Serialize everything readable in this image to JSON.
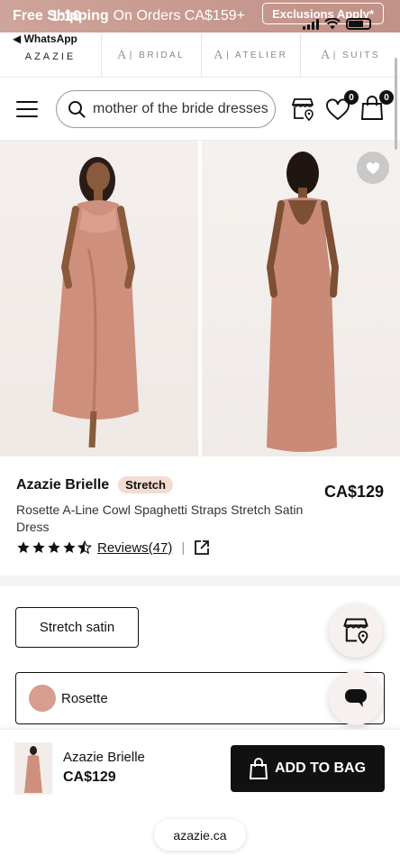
{
  "status_bar": {
    "time": "1:10"
  },
  "promo": {
    "free_label": "Free Shipping",
    "rest_label": "On Orders CA$159+",
    "exclusions_label": "Exclusions Apply*"
  },
  "back_link": {
    "label": "◀ WhatsApp"
  },
  "brand_row": {
    "main": "AZAZIE",
    "tabs": [
      {
        "logo": "A",
        "label": "| BRIDAL"
      },
      {
        "logo": "A",
        "label": "| ATELIER"
      },
      {
        "logo": "A",
        "label": "| SUITS"
      }
    ]
  },
  "header": {
    "search_value": "mother of the bride dresses",
    "wishlist_count": "0",
    "bag_count": "0"
  },
  "product": {
    "name": "Azazie Brielle",
    "tag": "Stretch",
    "price": "CA$129",
    "description": "Rosette A-Line Cowl Spaghetti Straps Stretch Satin Dress",
    "rating": 4.5,
    "reviews_label": "Reviews(47)",
    "separator": "|"
  },
  "options": {
    "fabric": "Stretch satin",
    "color_name": "Rosette",
    "color_hex": "#d79e90"
  },
  "sticky_bar": {
    "name": "Azazie Brielle",
    "price": "CA$129",
    "add_to_bag": "ADD TO BAG"
  },
  "browser": {
    "url": "azazie.ca"
  },
  "colors": {
    "accent": "#111111",
    "brand_pink": "#c89a90",
    "tag_bg": "#f3dcd1"
  }
}
